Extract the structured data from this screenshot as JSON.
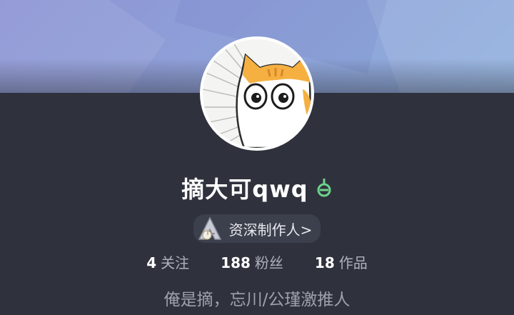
{
  "profile": {
    "name": "摘大可qwq",
    "gender_icon": "male-icon",
    "badge_label": "资深制作人>",
    "badge_icon": "creator-level-icon",
    "bio": "俺是摘，忘川/公瑾激推人"
  },
  "stats": {
    "following_count": "4",
    "following_label": "关注",
    "followers_count": "188",
    "followers_label": "粉丝",
    "works_count": "18",
    "works_label": "作品"
  },
  "colors": {
    "background": "#2f323d",
    "banner": "#8fa0d8",
    "gender_icon": "#6dd38a",
    "avatar_cat_orange": "#f5b041"
  }
}
